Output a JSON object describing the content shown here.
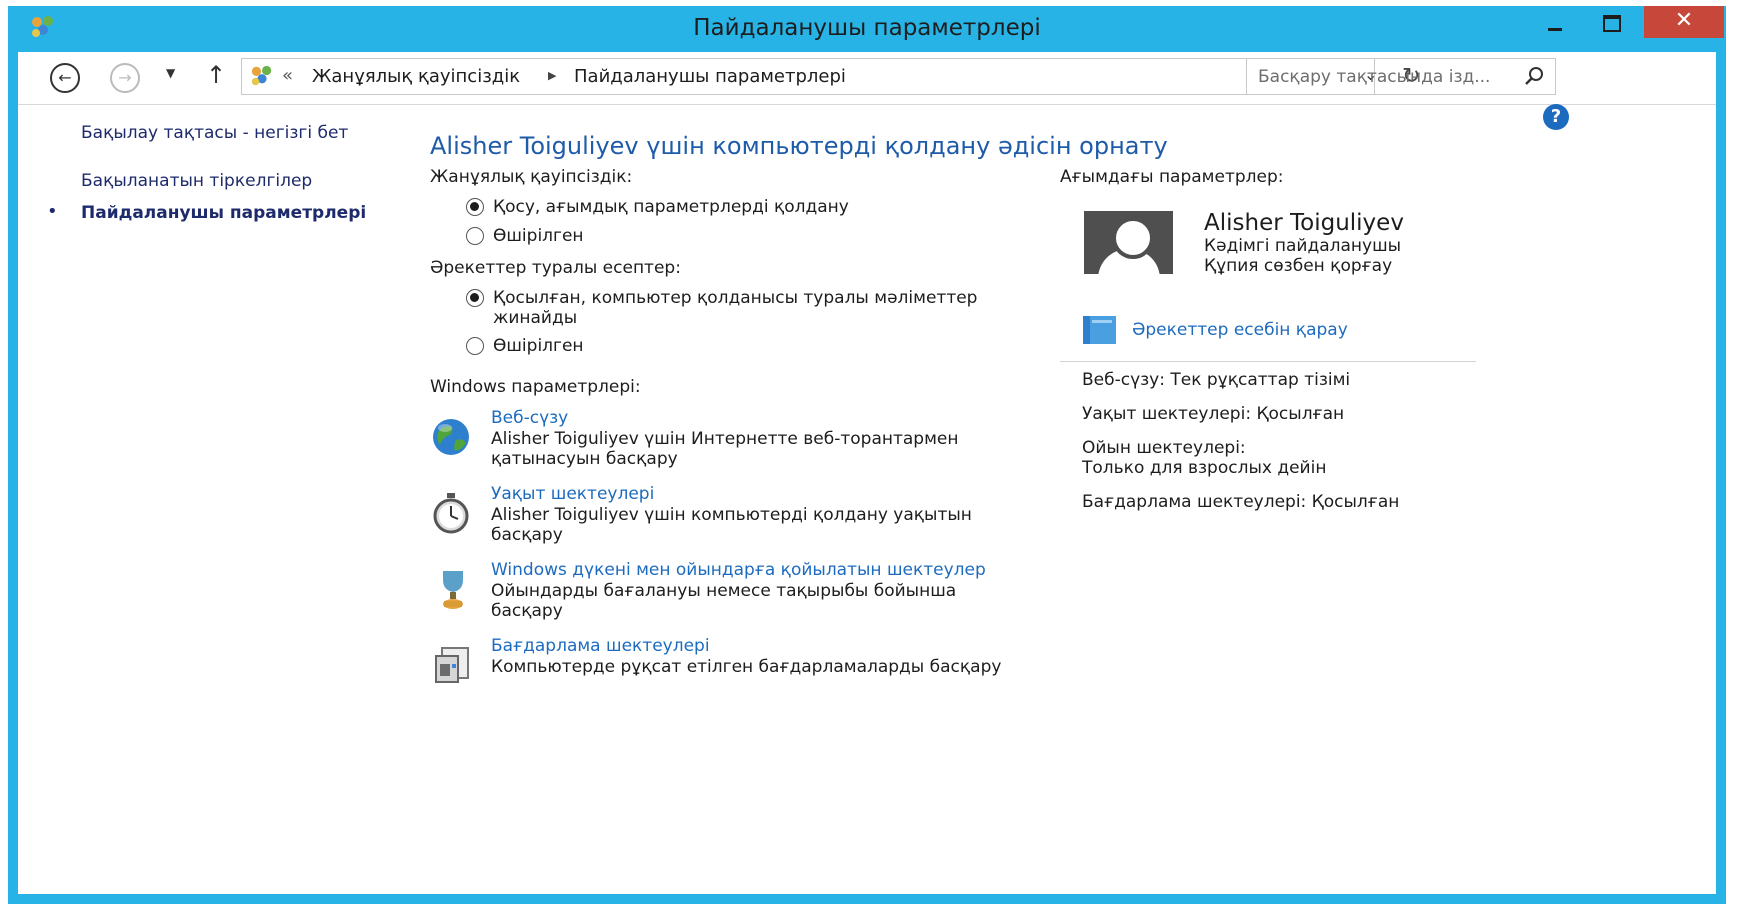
{
  "window": {
    "title": "Пайдаланушы параметрлері",
    "close_glyph": "✕",
    "accent_color": "#27b3e6",
    "close_color": "#c7473b"
  },
  "toolbar": {
    "back_icon": "back-arrow-icon",
    "forward_icon": "forward-arrow-icon",
    "up_icon": "up-arrow-icon",
    "breadcrumb": [
      "Жанұялық қауіпсіздік",
      "Пайдаланушы параметрлері"
    ],
    "search_placeholder": "Басқару тақтасында ізд..."
  },
  "sidebar": {
    "items": [
      {
        "label": "Бақылау тақтасы - негізгі бет"
      },
      {
        "label": "Бақыланатын тіркелгілер"
      },
      {
        "label": "Пайдаланушы параметрлері",
        "current": true
      }
    ]
  },
  "main": {
    "heading": "Alisher Toiguliyev үшін компьютерді қолдану әдісін орнату",
    "family_safety": {
      "label": "Жанұялық қауіпсіздік:",
      "options": [
        {
          "label": "Қосу, ағымдық параметрлерді қолдану",
          "selected": true
        },
        {
          "label": "Өшірілген",
          "selected": false
        }
      ]
    },
    "activity_reports": {
      "label": "Әрекеттер туралы есептер:",
      "options": [
        {
          "label": "Қосылған, компьютер қолданысы туралы мәліметтер жинайды",
          "selected": true
        },
        {
          "label": "Өшірілген",
          "selected": false
        }
      ]
    },
    "windows_settings": {
      "label": "Windows параметрлері:",
      "items": [
        {
          "icon": "globe-icon",
          "title": "Веб-сүзу",
          "desc": "Alisher Toiguliyev үшін Интернетте веб-торантармен қатынасуын басқару"
        },
        {
          "icon": "stopwatch-icon",
          "title": "Уақыт шектеулері",
          "desc": "Alisher Toiguliyev үшін компьютерді қолдану уақытын басқару"
        },
        {
          "icon": "trophy-icon",
          "title": "Windows дүкені мен ойындарға қойылатын шектеулер",
          "desc": "Ойындарды бағалануы немесе тақырыбы бойынша басқару"
        },
        {
          "icon": "app-restrictions-icon",
          "title": "Бағдарлама шектеулері",
          "desc": "Компьютерде рұқсат етілген бағдарламаларды басқару"
        }
      ]
    }
  },
  "current_settings": {
    "label": "Ағымдағы параметрлер:",
    "user": {
      "name": "Alisher Toiguliyev",
      "type": "Кәдімгі пайдаланушы",
      "password": "Құпия сөзбен қорғау"
    },
    "activity_link": "Әрекеттер есебін қарау",
    "summary": [
      "Веб-сүзу: Тек рұқсаттар тізімі",
      "Уақыт шектеулері: Қосылған",
      "Ойын шектеулері:",
      "Только для взрослых дейін",
      "Бағдарлама шектеулері: Қосылған"
    ]
  }
}
